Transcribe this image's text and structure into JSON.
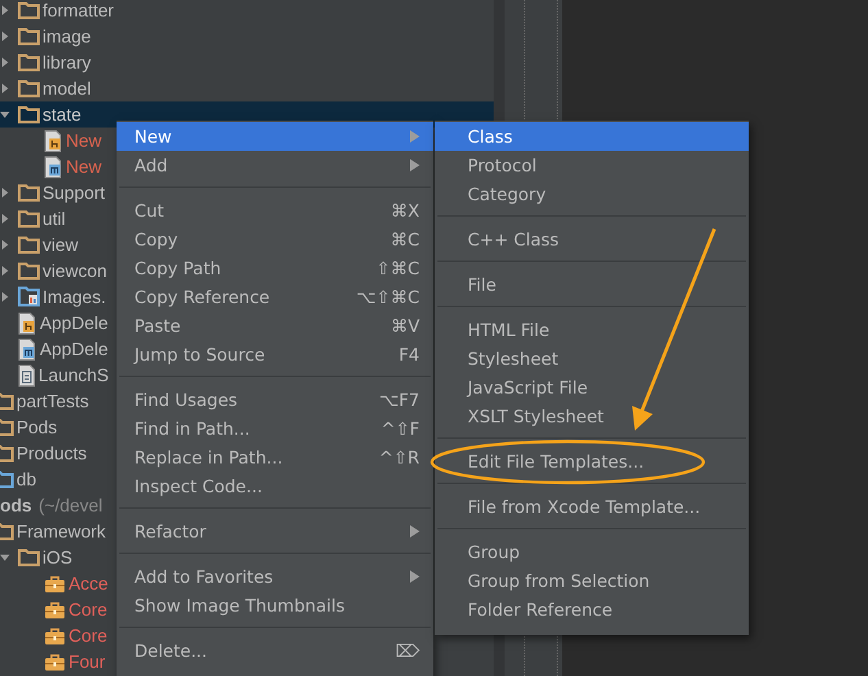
{
  "tree": [
    {
      "children": [
        {
          "label": "formatter",
          "kind": "folder",
          "expanded": false,
          "selected": false,
          "color": "#bbbbbb"
        },
        {
          "label": "image",
          "kind": "folder",
          "expanded": false,
          "selected": false,
          "color": "#bbbbbb"
        },
        {
          "label": "library",
          "kind": "folder",
          "expanded": false,
          "selected": false,
          "color": "#bbbbbb"
        },
        {
          "label": "model",
          "kind": "folder",
          "expanded": false,
          "selected": false,
          "color": "#bbbbbb"
        },
        {
          "label": "state",
          "kind": "folder",
          "expanded": true,
          "selected": true,
          "color": "#c8c8c8",
          "children": [
            {
              "label": "New",
              "kind": "header",
              "selected": false,
              "color": "#d9634f"
            },
            {
              "label": "New",
              "kind": "implementation",
              "selected": false,
              "color": "#d9634f"
            }
          ]
        },
        {
          "label": "Support",
          "kind": "folder",
          "expanded": false,
          "selected": false,
          "color": "#bbbbbb"
        },
        {
          "label": "util",
          "kind": "folder",
          "expanded": false,
          "selected": false,
          "color": "#bbbbbb"
        },
        {
          "label": "view",
          "kind": "folder",
          "expanded": false,
          "selected": false,
          "color": "#bbbbbb"
        },
        {
          "label": "viewcon",
          "kind": "folder",
          "expanded": false,
          "selected": false,
          "color": "#bbbbbb"
        },
        {
          "label": "Images.",
          "kind": "assets",
          "expanded": false,
          "selected": false,
          "color": "#bbbbbb"
        },
        {
          "label": "AppDele",
          "kind": "header",
          "selected": false,
          "color": "#bbbbbb"
        },
        {
          "label": "AppDele",
          "kind": "implementation",
          "selected": false,
          "color": "#bbbbbb"
        },
        {
          "label": "LaunchS",
          "kind": "interface",
          "selected": false,
          "color": "#bbbbbb"
        }
      ]
    },
    {
      "label": "partTests",
      "kind": "folder",
      "selected": false,
      "color": "#bbbbbb"
    },
    {
      "label": "Pods",
      "kind": "folder",
      "selected": false,
      "color": "#bbbbbb"
    },
    {
      "label": "Products",
      "kind": "folder",
      "selected": false,
      "color": "#bbbbbb"
    },
    {
      "label": "db",
      "kind": "source-folder",
      "selected": false,
      "color": "#bbbbbb"
    },
    {
      "label": "ods",
      "path": "(~/devel",
      "kind": "project",
      "selected": false,
      "color": "#bbbbbb",
      "children": [
        {
          "label": "Framework",
          "kind": "folder",
          "selected": false,
          "color": "#bbbbbb",
          "children": [
            {
              "label": "iOS",
              "kind": "folder",
              "expanded": true,
              "selected": false,
              "color": "#bbbbbb",
              "children": [
                {
                  "label": "Acce",
                  "kind": "framework",
                  "selected": false,
                  "color": "#e0605a"
                },
                {
                  "label": "Core",
                  "kind": "framework",
                  "selected": false,
                  "color": "#e0605a"
                },
                {
                  "label": "Core",
                  "kind": "framework",
                  "selected": false,
                  "color": "#e0605a"
                },
                {
                  "label": "Four",
                  "kind": "framework",
                  "selected": false,
                  "color": "#e0605a"
                }
              ]
            }
          ]
        }
      ]
    }
  ],
  "context_menu": [
    {
      "kind": "item",
      "label": "New",
      "submenu": true,
      "selected": true
    },
    {
      "kind": "item",
      "label": "Add",
      "submenu": true,
      "selected": false
    },
    {
      "kind": "separator"
    },
    {
      "kind": "item",
      "label": "Cut",
      "shortcut": "⌘X",
      "submenu": false,
      "selected": false
    },
    {
      "kind": "item",
      "label": "Copy",
      "shortcut": "⌘C",
      "submenu": false,
      "selected": false
    },
    {
      "kind": "item",
      "label": "Copy Path",
      "shortcut": "⇧⌘C",
      "submenu": false,
      "selected": false
    },
    {
      "kind": "item",
      "label": "Copy Reference",
      "shortcut": "⌥⇧⌘C",
      "submenu": false,
      "selected": false
    },
    {
      "kind": "item",
      "label": "Paste",
      "shortcut": "⌘V",
      "submenu": false,
      "selected": false
    },
    {
      "kind": "item",
      "label": "Jump to Source",
      "shortcut": "F4",
      "submenu": false,
      "selected": false
    },
    {
      "kind": "separator"
    },
    {
      "kind": "item",
      "label": "Find Usages",
      "shortcut": "⌥F7",
      "submenu": false,
      "selected": false
    },
    {
      "kind": "item",
      "label": "Find in Path...",
      "shortcut": "^⇧F",
      "submenu": false,
      "selected": false
    },
    {
      "kind": "item",
      "label": "Replace in Path...",
      "shortcut": "^⇧R",
      "submenu": false,
      "selected": false
    },
    {
      "kind": "item",
      "label": "Inspect Code...",
      "submenu": false,
      "selected": false
    },
    {
      "kind": "separator"
    },
    {
      "kind": "item",
      "label": "Refactor",
      "submenu": true,
      "selected": false
    },
    {
      "kind": "separator"
    },
    {
      "kind": "item",
      "label": "Add to Favorites",
      "submenu": true,
      "selected": false
    },
    {
      "kind": "item",
      "label": "Show Image Thumbnails",
      "submenu": false,
      "selected": false
    },
    {
      "kind": "separator"
    },
    {
      "kind": "item",
      "label": "Delete...",
      "shortcut": "⌦",
      "submenu": false,
      "selected": false
    }
  ],
  "new_submenu": [
    {
      "kind": "item",
      "label": "Class",
      "selected": true,
      "circled": false
    },
    {
      "kind": "item",
      "label": "Protocol",
      "selected": false,
      "circled": false
    },
    {
      "kind": "item",
      "label": "Category",
      "selected": false,
      "circled": false
    },
    {
      "kind": "separator"
    },
    {
      "kind": "item",
      "label": "C++ Class",
      "selected": false,
      "circled": false
    },
    {
      "kind": "separator"
    },
    {
      "kind": "item",
      "label": "File",
      "selected": false,
      "circled": false
    },
    {
      "kind": "separator"
    },
    {
      "kind": "item",
      "label": "HTML File",
      "selected": false,
      "circled": false
    },
    {
      "kind": "item",
      "label": "Stylesheet",
      "selected": false,
      "circled": false
    },
    {
      "kind": "item",
      "label": "JavaScript File",
      "selected": false,
      "circled": false
    },
    {
      "kind": "item",
      "label": "XSLT Stylesheet",
      "selected": false,
      "circled": false
    },
    {
      "kind": "separator"
    },
    {
      "kind": "item",
      "label": "Edit File Templates...",
      "selected": false,
      "circled": true
    },
    {
      "kind": "separator"
    },
    {
      "kind": "item",
      "label": "File from Xcode Template...",
      "selected": false,
      "circled": false
    },
    {
      "kind": "separator"
    },
    {
      "kind": "item",
      "label": "Group",
      "selected": false,
      "circled": false
    },
    {
      "kind": "item",
      "label": "Group from Selection",
      "selected": false,
      "circled": false
    },
    {
      "kind": "item",
      "label": "Folder Reference",
      "selected": false,
      "circled": false
    }
  ]
}
